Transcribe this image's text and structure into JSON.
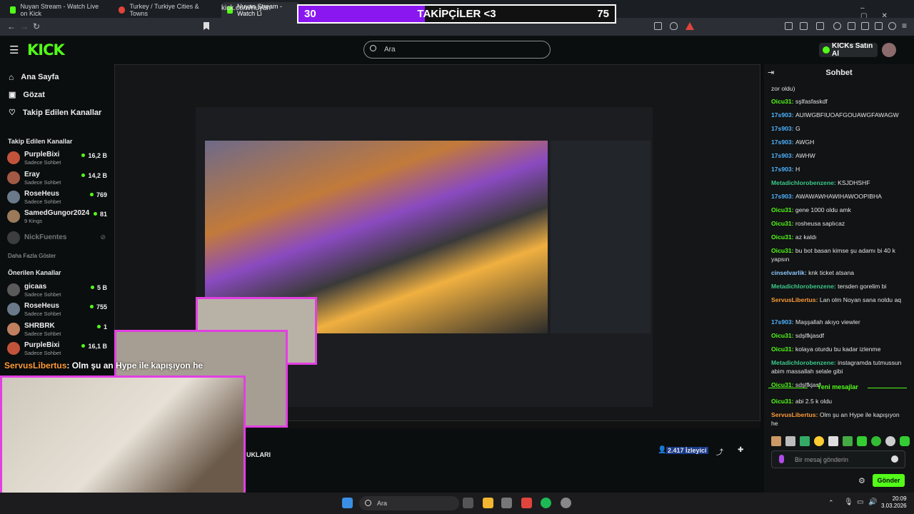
{
  "tabs": [
    {
      "label": "Nuyan Stream - Watch Live on Kick"
    },
    {
      "label": "Turkey / Turkiye Cities & Towns"
    },
    {
      "label": "Nuyan Stream - Watch Li"
    }
  ],
  "address": {
    "url": "kick.com/nuyan"
  },
  "header": {
    "logo": "KICK",
    "search_placeholder": "Ara",
    "buy_label": "KICKs Satın Al"
  },
  "sidebar": {
    "nav": [
      {
        "label": "Ana Sayfa",
        "icon": "home-icon"
      },
      {
        "label": "Gözat",
        "icon": "browse-icon"
      },
      {
        "label": "Takip Edilen Kanallar",
        "icon": "heart-icon"
      }
    ],
    "followed_title": "Takip Edilen Kanallar",
    "followed": [
      {
        "name": "PurpleBixi",
        "sub": "Sadece Sohbet",
        "viewers": "16,2 B"
      },
      {
        "name": "Eray",
        "sub": "Sadece Sohbet",
        "viewers": "14,2 B"
      },
      {
        "name": "RoseHeus",
        "sub": "Sadece Sohbet",
        "viewers": "769"
      },
      {
        "name": "SamedGungor2024",
        "sub": "9 Kings",
        "viewers": "81"
      },
      {
        "name": "NickFuentes",
        "sub": "",
        "viewers": ""
      }
    ],
    "more": "Daha Fazla Göster",
    "suggested_title": "Önerilen Kanallar",
    "suggested": [
      {
        "name": "gicaas",
        "sub": "Sadece Sohbet",
        "viewers": "5 B"
      },
      {
        "name": "RoseHeus",
        "sub": "Sadece Sohbet",
        "viewers": "755"
      },
      {
        "name": "SHRBRK",
        "sub": "Sadece Sohbet",
        "viewers": "1"
      },
      {
        "name": "PurpleBixi",
        "sub": "Sadece Sohbet",
        "viewers": "16,1 B"
      }
    ]
  },
  "widget": {
    "left": "30",
    "title": "TAKİPÇİLER <3",
    "right": "75",
    "fill": 0.4
  },
  "overlay": {
    "user": "ServusLibertus",
    "text": ": Olm şu an Hype ile kapışıyon he"
  },
  "stream": {
    "viewers": "2.417 İzleyici",
    "title_fragment": "UKLARI"
  },
  "chat": {
    "title": "Sohbet",
    "top_fragment": "zor oldu)",
    "messages": [
      {
        "user": "Oicu31",
        "color": "#53fc18",
        "text": "sşlfasfaskdf"
      },
      {
        "user": "17s903",
        "color": "#4fb3ff",
        "text": "AUIWGBFIUOAFGOUAWGFAWAGW"
      },
      {
        "user": "17s903",
        "color": "#4fb3ff",
        "text": "G"
      },
      {
        "user": "17s903",
        "color": "#4fb3ff",
        "text": "AWGH"
      },
      {
        "user": "17s903",
        "color": "#4fb3ff",
        "text": "AWHW"
      },
      {
        "user": "17s903",
        "color": "#4fb3ff",
        "text": "H"
      },
      {
        "user": "Metadichlorobenzene",
        "color": "#3cc98a",
        "text": "KSJDHSHF"
      },
      {
        "user": "17s903",
        "color": "#4fb3ff",
        "text": "AWAWAWHAWIHAWOOPIBHA"
      },
      {
        "user": "Oicu31",
        "color": "#53fc18",
        "text": "gene 1000 oldu amk"
      },
      {
        "user": "Oicu31",
        "color": "#53fc18",
        "text": "rosheusa saplıcaz"
      },
      {
        "user": "Oicu31",
        "color": "#53fc18",
        "text": "az kaldı"
      },
      {
        "user": "Oicu31",
        "color": "#53fc18",
        "text": "bu bot basan kimse şu adamı bi 40 k yapsın"
      },
      {
        "user": "cinselvarlik",
        "color": "#8fc8ff",
        "text": "knk ticket atsana"
      },
      {
        "user": "Metadichlorobenzene",
        "color": "#3cc98a",
        "text": "tersden gorelim bi"
      },
      {
        "user": "ServusLibertus",
        "color": "#ff9b3a",
        "text": "Lan olm Noyan sana noldu aq"
      },
      {
        "user": "17s903",
        "color": "#4fb3ff",
        "text": "Maşşallah akıyo viewler"
      },
      {
        "user": "Oicu31",
        "color": "#53fc18",
        "text": "sdşlfkjasdf"
      },
      {
        "user": "Oicu31",
        "color": "#53fc18",
        "text": "kolaya oturdu bu kadar izlenme"
      },
      {
        "user": "Metadichlorobenzene",
        "color": "#3cc98a",
        "text": "instagramda tutmussun abim massallah selale gibi"
      },
      {
        "user": "Oicu31",
        "color": "#53fc18",
        "text": "sdşlfkjasf"
      }
    ],
    "new_label": "Yeni mesajlar",
    "new_messages": [
      {
        "user": "Oicu31",
        "color": "#53fc18",
        "text": "abi 2.5 k oldu"
      },
      {
        "user": "ServusLibertus",
        "color": "#ff9b3a",
        "text": "Olm şu an Hype ile kapışıyon he"
      }
    ],
    "input_placeholder": "Bir mesaj gönderin",
    "send_label": "Gönder"
  },
  "taskbar": {
    "search": "Ara",
    "time": "20:09",
    "date": "3.03.2026"
  }
}
